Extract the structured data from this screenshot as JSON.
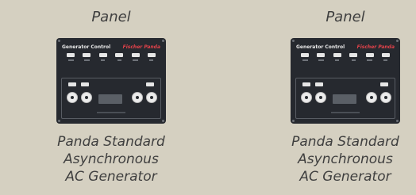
{
  "cards": [
    {
      "title": "Panel",
      "panel": {
        "header": "Generator Control",
        "brand": "Fischer Panda"
      },
      "caption": {
        "line1": "Panda Standard",
        "line2": "Asynchronous",
        "line3": "AC Generator"
      }
    },
    {
      "title": "Panel",
      "panel": {
        "header": "Generator Control",
        "brand": "Fischer Panda"
      },
      "caption": {
        "line1": "Panda Standard",
        "line2": "Asynchronous",
        "line3": "AC Generator"
      }
    }
  ],
  "colors": {
    "background": "#d5d0c1",
    "panel": "#26292f",
    "brand_red": "#e2424a",
    "text": "#3f3f3f"
  }
}
